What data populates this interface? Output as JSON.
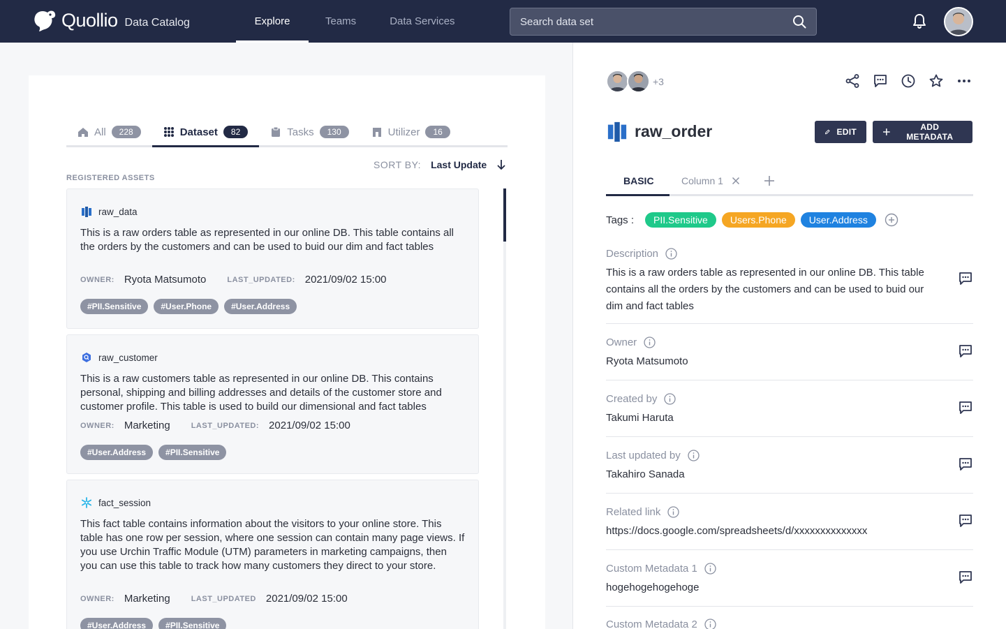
{
  "header": {
    "brand": "Quollio",
    "brand_sub": "Data Catalog",
    "nav": [
      "Explore",
      "Teams",
      "Data Services"
    ],
    "search_placeholder": "Search data set"
  },
  "left": {
    "tabs": [
      {
        "label": "All",
        "count": "228",
        "icon": "home-icon"
      },
      {
        "label": "Dataset",
        "count": "82",
        "icon": "grid-icon"
      },
      {
        "label": "Tasks",
        "count": "130",
        "icon": "clipboard-icon"
      },
      {
        "label": "Utilizer",
        "count": "16",
        "icon": "bookmark-icon"
      }
    ],
    "sort_label": "SORT BY:",
    "sort_value": "Last Update",
    "section_label": "REGISTERED ASSETS",
    "cards": [
      {
        "name": "raw_data",
        "description": "This is a raw orders table as represented in our online DB. This table contains all the orders by the customers and can be used to buid our dim and fact tables",
        "owner_label": "OWNER:",
        "owner": "Ryota Matsumoto",
        "updated_label": "LAST_UPDATED:",
        "updated": "2021/09/02 15:00",
        "tags": [
          "#PII.Sensitive",
          "#User.Phone",
          "#User.Address"
        ]
      },
      {
        "name": "raw_customer",
        "description": "This is a raw customers table as represented in our online DB. This contains personal, shipping and billing addresses and details of the customer store and customer profile. This table is used to build our dimensional and fact tables",
        "owner_label": "OWNER:",
        "owner": "Marketing",
        "updated_label": "LAST_UPDATED:",
        "updated": "2021/09/02 15:00",
        "tags": [
          "#User.Address",
          "#PII.Sensitive"
        ]
      },
      {
        "name": "fact_session",
        "description": "This fact table contains information about the visitors to your online store. This table has one row per session, where one session can contain many page views. If you use Urchin Traffic Module (UTM) parameters in marketing campaigns, then you can use this table to track how many customers they direct to your store.",
        "owner_label": "OWNER:",
        "owner": "Marketing",
        "updated_label": "LAST_UPDATED",
        "updated": "2021/09/02 15:00",
        "tags": [
          "#User.Address",
          "#PII.Sensitive"
        ]
      }
    ]
  },
  "right": {
    "more_avatars": "+3",
    "asset_name": "raw_order",
    "edit_label": "EDIT",
    "add_metadata_label": "ADD METADATA",
    "tabs": [
      "BASIC",
      "Column 1"
    ],
    "tags_label": "Tags :",
    "tags": [
      {
        "label": "PII.Sensitive",
        "color": "#1fc98a"
      },
      {
        "label": "Users.Phone",
        "color": "#f5a623"
      },
      {
        "label": "User.Address",
        "color": "#1f82e0"
      }
    ],
    "fields": [
      {
        "label": "Description",
        "value": "This is a raw orders table as represented in our online DB. This table contains all the orders by the customers and can be used to buid our dim and fact tables"
      },
      {
        "label": "Owner",
        "value": "Ryota Matsumoto"
      },
      {
        "label": "Created by",
        "value": "Takumi Haruta"
      },
      {
        "label": "Last updated by",
        "value": "Takahiro Sanada"
      },
      {
        "label": "Related link",
        "value": "https://docs.google.com/spreadsheets/d/xxxxxxxxxxxxxx"
      },
      {
        "label": "Custom Metadata 1",
        "value": "hogehogehogehoge"
      },
      {
        "label": "Custom Metadata 2",
        "value": ""
      }
    ]
  }
}
